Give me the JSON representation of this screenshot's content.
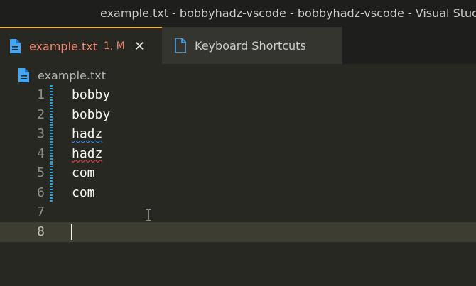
{
  "window": {
    "title": "example.txt - bobbyhadz-vscode - bobbyhadz-vscode - Visual Studio Code"
  },
  "tabs": [
    {
      "label": "example.txt",
      "badge": "1, M",
      "close": "✕",
      "icon": "file-icon",
      "active": true
    },
    {
      "label": "Keyboard Shortcuts",
      "icon": "file-icon",
      "active": false
    }
  ],
  "breadcrumb": {
    "label": "example.txt",
    "icon": "file-icon"
  },
  "editor": {
    "lines": [
      {
        "num": "1",
        "text": "bobby"
      },
      {
        "num": "2",
        "text": "bobby"
      },
      {
        "num": "3",
        "text": "hadz"
      },
      {
        "num": "4",
        "text": "hadz"
      },
      {
        "num": "5",
        "text": "com"
      },
      {
        "num": "6",
        "text": "com"
      },
      {
        "num": "7",
        "text": ""
      },
      {
        "num": "8",
        "text": ""
      }
    ]
  },
  "colors": {
    "editor_bg": "#272822",
    "tab_active_border": "#f7a84a",
    "modified_text": "#f48771",
    "file_icon": "#42a5f5",
    "dirty_gutter": "#2d9fd6"
  }
}
